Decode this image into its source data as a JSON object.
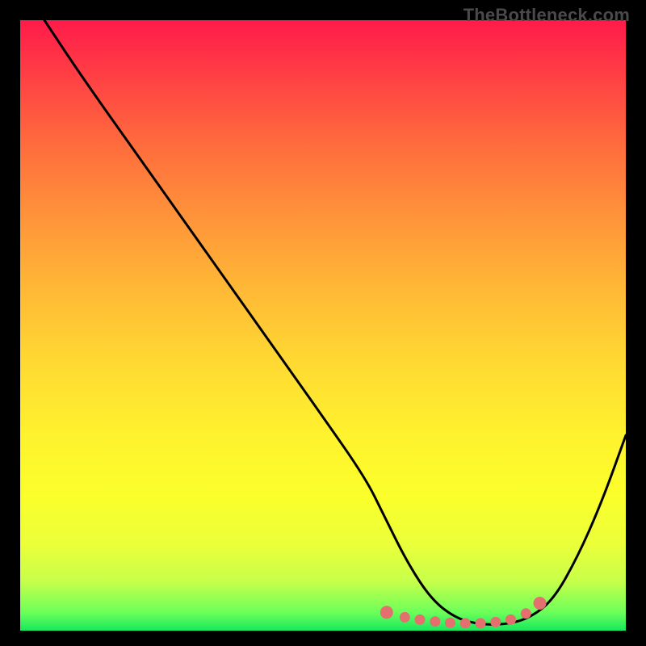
{
  "watermark": "TheBottleneck.com",
  "chart_data": {
    "type": "line",
    "title": "",
    "xlabel": "",
    "ylabel": "",
    "xlim": [
      0,
      100
    ],
    "ylim": [
      0,
      100
    ],
    "series": [
      {
        "name": "curve",
        "x": [
          4,
          10,
          20,
          30,
          40,
          50,
          57,
          60,
          64,
          68,
          72,
          76,
          80,
          84,
          88,
          92,
          96,
          100
        ],
        "y": [
          100,
          91,
          77,
          63,
          49,
          35,
          25,
          19,
          11,
          5,
          2,
          1,
          1,
          2,
          5,
          12,
          21,
          32
        ]
      }
    ],
    "markers": {
      "name": "highlight-dots",
      "color": "#e36f6f",
      "x": [
        60.5,
        63.5,
        66,
        68.5,
        71,
        73.5,
        76,
        78.5,
        81,
        83.5,
        85.8
      ],
      "y": [
        3.0,
        2.2,
        1.8,
        1.5,
        1.3,
        1.2,
        1.2,
        1.4,
        1.8,
        2.8,
        4.5
      ]
    },
    "gradient_stops": [
      {
        "pos": 0,
        "color": "#ff1b4a"
      },
      {
        "pos": 8,
        "color": "#ff3b45"
      },
      {
        "pos": 20,
        "color": "#ff6a3d"
      },
      {
        "pos": 32,
        "color": "#ff933a"
      },
      {
        "pos": 44,
        "color": "#ffb836"
      },
      {
        "pos": 56,
        "color": "#ffd932"
      },
      {
        "pos": 68,
        "color": "#fff22e"
      },
      {
        "pos": 78,
        "color": "#fbff2b"
      },
      {
        "pos": 86,
        "color": "#eaff3a"
      },
      {
        "pos": 92,
        "color": "#c6ff4a"
      },
      {
        "pos": 97,
        "color": "#6cff5a"
      },
      {
        "pos": 100,
        "color": "#17e85d"
      }
    ]
  }
}
